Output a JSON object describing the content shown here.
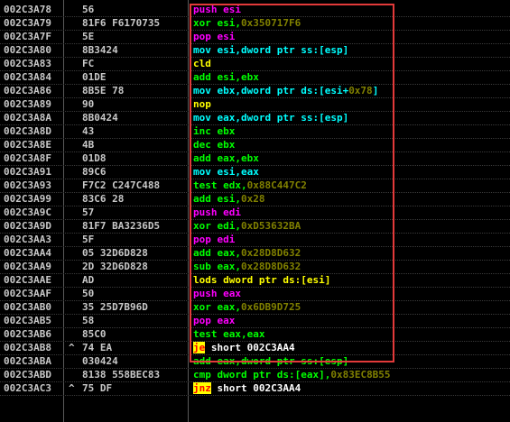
{
  "colors": {
    "address": "#c8c8c8",
    "hex": "#c8c8c8",
    "push_pop": "#ff00ff",
    "arith_logic": "#00ff00",
    "mov": "#00ffff",
    "control": "#ffff00",
    "jump": "#ffffff",
    "constant": "#808000",
    "annotation_box": "#e23a3a"
  },
  "rows": [
    {
      "addr": "002C3A78",
      "mark": "",
      "hex": "56",
      "seg": [
        {
          "t": "push esi",
          "c": "push_pop"
        }
      ]
    },
    {
      "addr": "002C3A79",
      "mark": "",
      "hex": "81F6 F6170735",
      "seg": [
        {
          "t": "xor esi,",
          "c": "arith_logic"
        },
        {
          "t": "0x350717F6",
          "c": "constant"
        }
      ]
    },
    {
      "addr": "002C3A7F",
      "mark": "",
      "hex": "5E",
      "seg": [
        {
          "t": "pop esi",
          "c": "push_pop"
        }
      ]
    },
    {
      "addr": "002C3A80",
      "mark": "",
      "hex": "8B3424",
      "seg": [
        {
          "t": "mov esi,dword ptr ss:[esp]",
          "c": "mov"
        }
      ]
    },
    {
      "addr": "002C3A83",
      "mark": "",
      "hex": "FC",
      "seg": [
        {
          "t": "cld",
          "c": "control"
        }
      ]
    },
    {
      "addr": "002C3A84",
      "mark": "",
      "hex": "01DE",
      "seg": [
        {
          "t": "add esi,ebx",
          "c": "arith_logic"
        }
      ]
    },
    {
      "addr": "002C3A86",
      "mark": "",
      "hex": "8B5E 78",
      "seg": [
        {
          "t": "mov ebx,dword ptr ds:[esi+",
          "c": "mov"
        },
        {
          "t": "0x78",
          "c": "constant"
        },
        {
          "t": "]",
          "c": "mov"
        }
      ]
    },
    {
      "addr": "002C3A89",
      "mark": "",
      "hex": "90",
      "seg": [
        {
          "t": "nop",
          "c": "control"
        }
      ]
    },
    {
      "addr": "002C3A8A",
      "mark": "",
      "hex": "8B0424",
      "seg": [
        {
          "t": "mov eax,dword ptr ss:[esp]",
          "c": "mov"
        }
      ]
    },
    {
      "addr": "002C3A8D",
      "mark": "",
      "hex": "43",
      "seg": [
        {
          "t": "inc ebx",
          "c": "arith_logic"
        }
      ]
    },
    {
      "addr": "002C3A8E",
      "mark": "",
      "hex": "4B",
      "seg": [
        {
          "t": "dec ebx",
          "c": "arith_logic"
        }
      ]
    },
    {
      "addr": "002C3A8F",
      "mark": "",
      "hex": "01D8",
      "seg": [
        {
          "t": "add eax,ebx",
          "c": "arith_logic"
        }
      ]
    },
    {
      "addr": "002C3A91",
      "mark": "",
      "hex": "89C6",
      "seg": [
        {
          "t": "mov esi,eax",
          "c": "mov"
        }
      ]
    },
    {
      "addr": "002C3A93",
      "mark": "",
      "hex": "F7C2 C247C488",
      "seg": [
        {
          "t": "test edx,",
          "c": "arith_logic"
        },
        {
          "t": "0x88C447C2",
          "c": "constant"
        }
      ]
    },
    {
      "addr": "002C3A99",
      "mark": "",
      "hex": "83C6 28",
      "seg": [
        {
          "t": "add esi,",
          "c": "arith_logic"
        },
        {
          "t": "0x28",
          "c": "constant"
        }
      ]
    },
    {
      "addr": "002C3A9C",
      "mark": "",
      "hex": "57",
      "seg": [
        {
          "t": "push edi",
          "c": "push_pop"
        }
      ]
    },
    {
      "addr": "002C3A9D",
      "mark": "",
      "hex": "81F7 BA3236D5",
      "seg": [
        {
          "t": "xor edi,",
          "c": "arith_logic"
        },
        {
          "t": "0xD53632BA",
          "c": "constant"
        }
      ]
    },
    {
      "addr": "002C3AA3",
      "mark": "",
      "hex": "5F",
      "seg": [
        {
          "t": "pop edi",
          "c": "push_pop"
        }
      ]
    },
    {
      "addr": "002C3AA4",
      "mark": "",
      "hex": "05 32D6D828",
      "seg": [
        {
          "t": "add eax,",
          "c": "arith_logic"
        },
        {
          "t": "0x28D8D632",
          "c": "constant"
        }
      ]
    },
    {
      "addr": "002C3AA9",
      "mark": "",
      "hex": "2D 32D6D828",
      "seg": [
        {
          "t": "sub eax,",
          "c": "arith_logic"
        },
        {
          "t": "0x28D8D632",
          "c": "constant"
        }
      ]
    },
    {
      "addr": "002C3AAE",
      "mark": "",
      "hex": "AD",
      "seg": [
        {
          "t": "lods dword ptr ds:[esi]",
          "c": "control"
        }
      ]
    },
    {
      "addr": "002C3AAF",
      "mark": "",
      "hex": "50",
      "seg": [
        {
          "t": "push eax",
          "c": "push_pop"
        }
      ]
    },
    {
      "addr": "002C3AB0",
      "mark": "",
      "hex": "35 25D7B96D",
      "seg": [
        {
          "t": "xor eax,",
          "c": "arith_logic"
        },
        {
          "t": "0x6DB9D725",
          "c": "constant"
        }
      ]
    },
    {
      "addr": "002C3AB5",
      "mark": "",
      "hex": "58",
      "seg": [
        {
          "t": "pop eax",
          "c": "push_pop"
        }
      ]
    },
    {
      "addr": "002C3AB6",
      "mark": "",
      "hex": "85C0",
      "seg": [
        {
          "t": "test eax,eax",
          "c": "arith_logic"
        }
      ]
    },
    {
      "addr": "002C3AB8",
      "mark": "^",
      "hex": "74 EA",
      "seg": [
        {
          "t": "je",
          "c": "jump",
          "hl": true
        },
        {
          "t": " short 002C3AA4",
          "c": "jump"
        }
      ]
    },
    {
      "addr": "002C3ABA",
      "mark": "",
      "hex": "030424",
      "seg": [
        {
          "t": "add eax,dword ptr ss:[esp]",
          "c": "arith_logic"
        }
      ]
    },
    {
      "addr": "002C3ABD",
      "mark": "",
      "hex": "8138 558BEC83",
      "seg": [
        {
          "t": "cmp dword ptr ds:[eax],",
          "c": "arith_logic"
        },
        {
          "t": "0x83EC8B55",
          "c": "constant"
        }
      ]
    },
    {
      "addr": "002C3AC3",
      "mark": "^",
      "hex": "75 DF",
      "seg": [
        {
          "t": "jnz",
          "c": "jump",
          "hl": true
        },
        {
          "t": " short 002C3AA4",
          "c": "jump"
        }
      ]
    }
  ]
}
